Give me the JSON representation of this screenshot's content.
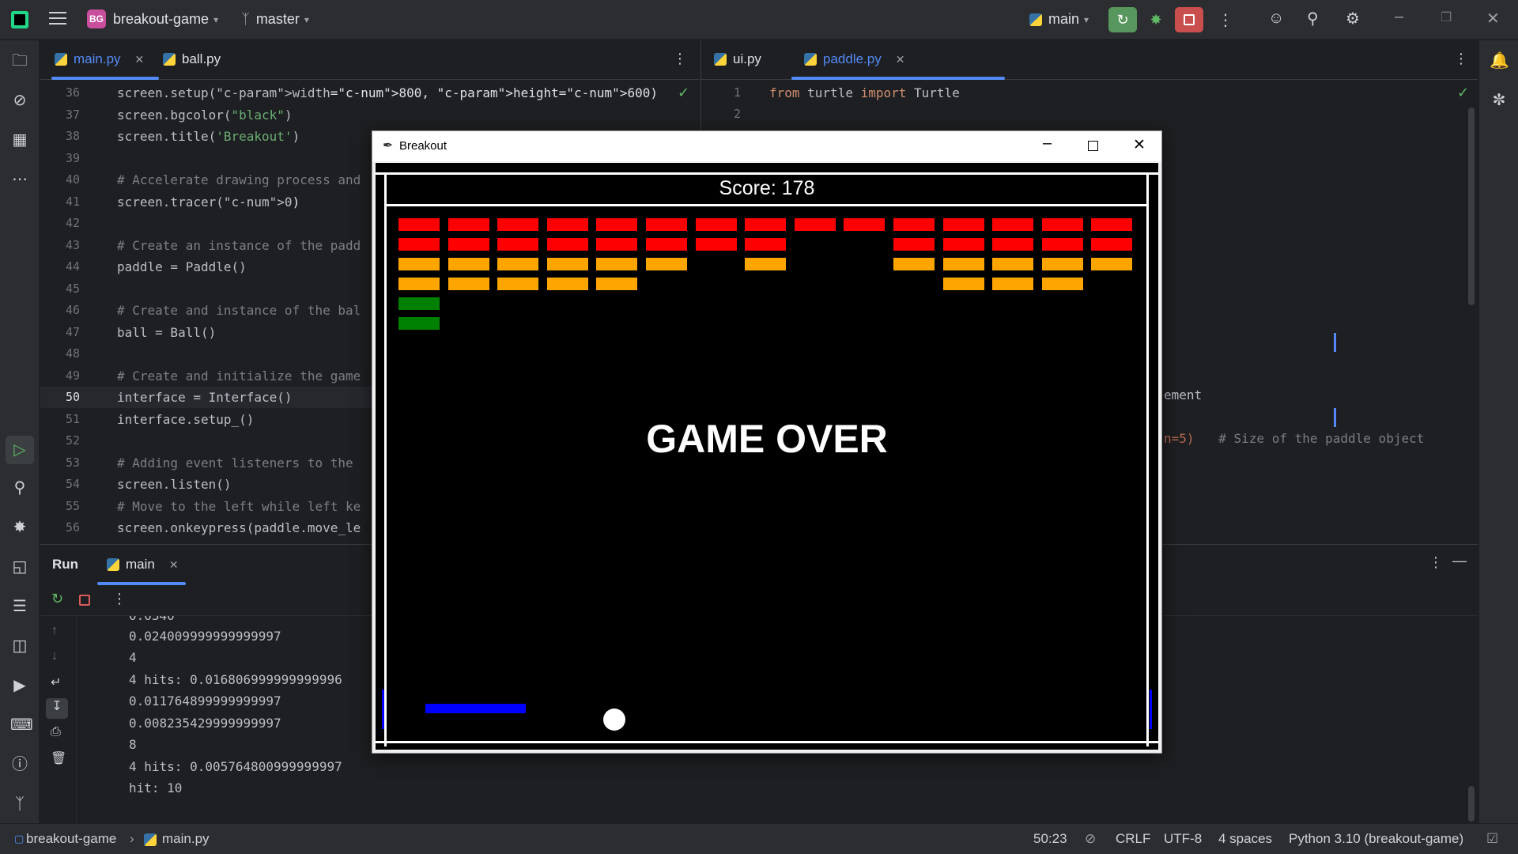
{
  "titlebar": {
    "project_badge": "BG",
    "project_name": "breakout-game",
    "branch": "master",
    "run_config": "main"
  },
  "editor_left": {
    "tabs": [
      {
        "label": "main.py",
        "active": true
      },
      {
        "label": "ball.py",
        "active": false
      }
    ],
    "lines": [
      {
        "num": "36",
        "text": "screen.setup(width=800, height=600)"
      },
      {
        "num": "37",
        "text": "screen.bgcolor(\"black\")"
      },
      {
        "num": "38",
        "text": "screen.title('Breakout')"
      },
      {
        "num": "39",
        "text": ""
      },
      {
        "num": "40",
        "text": "# Accelerate drawing process and"
      },
      {
        "num": "41",
        "text": "screen.tracer(0)"
      },
      {
        "num": "42",
        "text": ""
      },
      {
        "num": "43",
        "text": "# Create an instance of the padd"
      },
      {
        "num": "44",
        "text": "paddle = Paddle()"
      },
      {
        "num": "45",
        "text": ""
      },
      {
        "num": "46",
        "text": "# Create and instance of the bal"
      },
      {
        "num": "47",
        "text": "ball = Ball()"
      },
      {
        "num": "48",
        "text": ""
      },
      {
        "num": "49",
        "text": "# Create and initialize the game"
      },
      {
        "num": "50",
        "text": "interface = Interface()"
      },
      {
        "num": "51",
        "text": "interface.setup_()"
      },
      {
        "num": "52",
        "text": ""
      },
      {
        "num": "53",
        "text": "# Adding event listeners to the "
      },
      {
        "num": "54",
        "text": "screen.listen()"
      },
      {
        "num": "55",
        "text": "# Move to the left while left ke"
      },
      {
        "num": "56",
        "text": "screen.onkeypress(paddle.move_le"
      }
    ]
  },
  "editor_right": {
    "tabs": [
      {
        "label": "ui.py",
        "active": false
      },
      {
        "label": "paddle.py",
        "active": true
      }
    ],
    "lines": [
      {
        "num": "1",
        "text": "from turtle import Turtle"
      },
      {
        "num": "2",
        "text": ""
      }
    ],
    "fragment_1": "ement",
    "fragment_2a": "n=5)",
    "fragment_2b": "  # Size of the paddle object"
  },
  "run_panel": {
    "title": "Run",
    "tab": "main",
    "output": [
      "0.0340",
      "0.024009999999999997",
      "4",
      "4 hits: 0.016806999999999996",
      "0.011764899999999997",
      "0.008235429999999997",
      "8",
      "4 hits: 0.005764800999999997",
      "hit: 10"
    ]
  },
  "statusbar": {
    "project": "breakout-game",
    "file": "main.py",
    "position": "50:23",
    "line_ending": "CRLF",
    "encoding": "UTF-8",
    "indent": "4 spaces",
    "interpreter": "Python 3.10 (breakout-game)"
  },
  "game_window": {
    "title": "Breakout",
    "score": "Score: 178",
    "game_over": "GAME OVER",
    "colors": {
      "red": "#ff0000",
      "orange": "#ffa500",
      "green": "#008000",
      "paddle": "#0000ff",
      "ball": "#ffffff"
    },
    "bricks": {
      "row1": [
        1,
        1,
        1,
        1,
        1,
        1,
        1,
        1,
        1,
        1,
        1,
        1,
        1,
        1,
        1
      ],
      "row2": [
        1,
        1,
        1,
        1,
        1,
        1,
        1,
        1,
        0,
        0,
        1,
        1,
        1,
        1,
        1
      ],
      "row3": [
        1,
        1,
        1,
        1,
        1,
        1,
        0,
        1,
        0,
        0,
        1,
        1,
        1,
        1,
        1
      ],
      "row4": [
        1,
        1,
        1,
        1,
        1,
        0,
        0,
        0,
        0,
        0,
        0,
        1,
        1,
        1,
        0
      ],
      "row5": [
        1,
        0,
        0,
        0,
        0,
        0,
        0,
        0,
        0,
        0,
        0,
        0,
        0,
        0,
        0
      ],
      "row6": [
        1,
        0,
        0,
        0,
        0,
        0,
        0,
        0,
        0,
        0,
        0,
        0,
        0,
        0,
        0
      ]
    }
  }
}
